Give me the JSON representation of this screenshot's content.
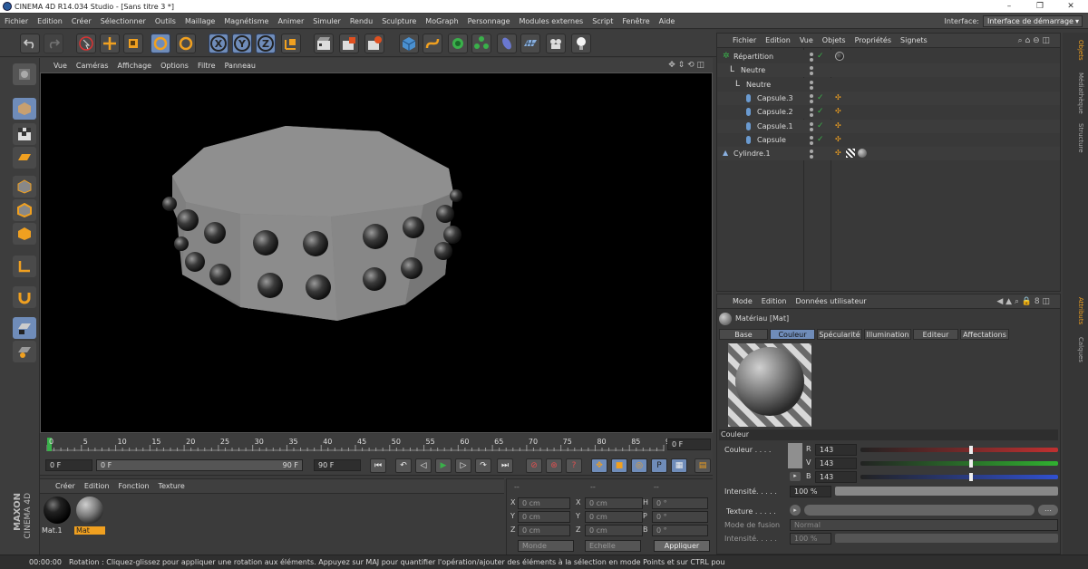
{
  "window": {
    "title": "CINEMA 4D R14.034 Studio - [Sans titre 3 *]",
    "minimize": "–",
    "maximize": "❐",
    "close": "✕"
  },
  "menu": [
    "Fichier",
    "Edition",
    "Créer",
    "Sélectionner",
    "Outils",
    "Maillage",
    "Magnétisme",
    "Animer",
    "Simuler",
    "Rendu",
    "Sculpture",
    "MoGraph",
    "Personnage",
    "Modules externes",
    "Script",
    "Fenêtre",
    "Aide"
  ],
  "interface": {
    "label": "Interface:",
    "value": "Interface de démarrage"
  },
  "toolbar": {
    "x": "X",
    "y": "Y",
    "z": "Z"
  },
  "viewport_menu": [
    "Vue",
    "Caméras",
    "Affichage",
    "Options",
    "Filtre",
    "Panneau"
  ],
  "timeline": {
    "ticks": [
      "0",
      "5",
      "10",
      "15",
      "20",
      "25",
      "30",
      "35",
      "40",
      "45",
      "50",
      "55",
      "60",
      "65",
      "70",
      "75",
      "80",
      "85",
      "90"
    ],
    "end_field": "0 F"
  },
  "transport": {
    "start": "0 F",
    "range_start": "0 F",
    "range_end": "90 F",
    "max": "90 F"
  },
  "material_menu": [
    "Créer",
    "Edition",
    "Fonction",
    "Texture"
  ],
  "materials": [
    {
      "name": "Mat.1"
    },
    {
      "name": "Mat"
    }
  ],
  "coords": {
    "headers": [
      "--",
      "--",
      "--"
    ],
    "rows": [
      {
        "a": "X",
        "av": "0 cm",
        "b": "X",
        "bv": "0 cm",
        "c": "H",
        "cv": "0 °"
      },
      {
        "a": "Y",
        "av": "0 cm",
        "b": "Y",
        "bv": "0 cm",
        "c": "P",
        "cv": "0 °"
      },
      {
        "a": "Z",
        "av": "0 cm",
        "b": "Z",
        "bv": "0 cm",
        "c": "B",
        "cv": "0 °"
      }
    ],
    "mode1": "Monde",
    "mode2": "Echelle",
    "apply": "Appliquer"
  },
  "objects_menu": [
    "Fichier",
    "Edition",
    "Vue",
    "Objets",
    "Propriétés",
    "Signets"
  ],
  "objects": [
    {
      "name": "Répartition"
    },
    {
      "name": "Neutre"
    },
    {
      "name": "Neutre"
    },
    {
      "name": "Capsule.3"
    },
    {
      "name": "Capsule.2"
    },
    {
      "name": "Capsule.1"
    },
    {
      "name": "Capsule"
    },
    {
      "name": "Cylindre.1"
    }
  ],
  "attr_menu": [
    "Mode",
    "Edition",
    "Données utilisateur"
  ],
  "attr": {
    "title": "Matériau [Mat]",
    "tabs": [
      "Base",
      "Couleur",
      "Spécularité",
      "Illumination",
      "Editeur",
      "Affectations"
    ],
    "active_tab": "Couleur",
    "section": "Couleur",
    "color_label": "Couleur . . . .",
    "r_label": "R",
    "v_label": "V",
    "b_label": "B",
    "r": "143",
    "v": "143",
    "b": "143",
    "intensity_label": "Intensité. . . . .",
    "intensity": "100 %",
    "texture_label": "Texture . . . . .",
    "mix_label": "Mode de fusion",
    "mix_value": "Normal",
    "mix_intensity_label": "Intensité. . . . .",
    "mix_intensity": "100 %",
    "swatch_color": "#8f8f8f"
  },
  "sidetabs": {
    "top": [
      "Objets",
      "Médiathèque",
      "Structure"
    ],
    "bottom": [
      "Attributs",
      "Calques"
    ]
  },
  "status": {
    "time": "00:00:00",
    "message": "Rotation : Cliquez-glissez pour appliquer une rotation aux éléments. Appuyez sur MAJ pour quantifier l'opération/ajouter des éléments à la sélection en mode Points et sur CTRL pou"
  },
  "logo": {
    "line1": "MAXON",
    "line2": "CINEMA 4D"
  }
}
